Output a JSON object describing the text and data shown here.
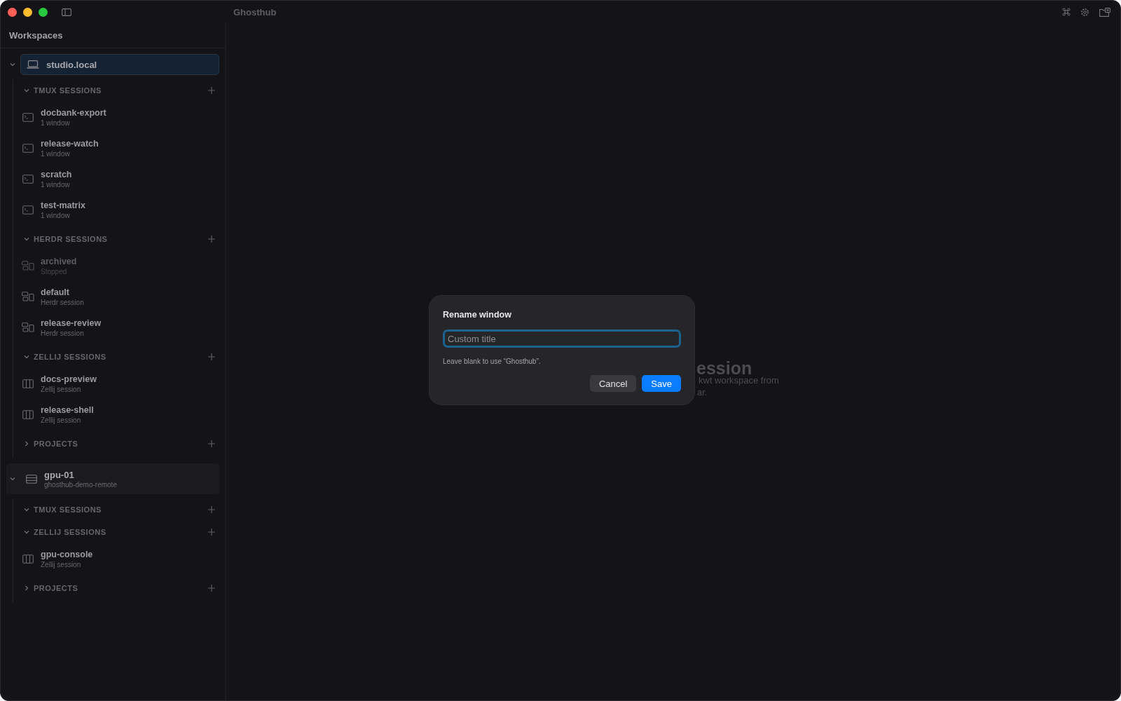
{
  "window": {
    "title": "Ghosthub"
  },
  "sidebar": {
    "title": "Workspaces",
    "workspaces": [
      {
        "name": "studio.local",
        "kind": "laptop",
        "selected": true,
        "expanded": true,
        "groups": [
          {
            "label": "TMUX SESSIONS",
            "expanded": true,
            "items": [
              {
                "name": "docbank-export",
                "detail": "1 window",
                "kind": "terminal",
                "disabled": false
              },
              {
                "name": "release-watch",
                "detail": "1 window",
                "kind": "terminal",
                "disabled": false
              },
              {
                "name": "scratch",
                "detail": "1 window",
                "kind": "terminal",
                "disabled": false
              },
              {
                "name": "test-matrix",
                "detail": "1 window",
                "kind": "terminal",
                "disabled": false
              }
            ]
          },
          {
            "label": "HERDR SESSIONS",
            "expanded": true,
            "items": [
              {
                "name": "archived",
                "detail": "Stopped",
                "kind": "panes",
                "disabled": true
              },
              {
                "name": "default",
                "detail": "Herdr session",
                "kind": "panes",
                "disabled": false
              },
              {
                "name": "release-review",
                "detail": "Herdr session",
                "kind": "panes",
                "disabled": false
              }
            ]
          },
          {
            "label": "ZELLIJ SESSIONS",
            "expanded": true,
            "items": [
              {
                "name": "docs-preview",
                "detail": "Zellij session",
                "kind": "columns",
                "disabled": false
              },
              {
                "name": "release-shell",
                "detail": "Zellij session",
                "kind": "columns",
                "disabled": false
              }
            ]
          },
          {
            "label": "PROJECTS",
            "expanded": false
          }
        ]
      },
      {
        "name": "gpu-01",
        "subtitle": "ghosthub-demo-remote",
        "kind": "server",
        "selected": false,
        "expanded": true,
        "groups": [
          {
            "label": "TMUX SESSIONS",
            "expanded": true
          },
          {
            "label": "ZELLIJ SESSIONS",
            "expanded": true,
            "items": [
              {
                "name": "gpu-console",
                "detail": "Zellij session",
                "kind": "columns",
                "disabled": false
              }
            ]
          },
          {
            "label": "PROJECTS",
            "expanded": false
          }
        ]
      }
    ]
  },
  "background": {
    "heading": "ession",
    "lines": [
      "kwt workspace from",
      "ar."
    ]
  },
  "dialog": {
    "title": "Rename window",
    "field": {
      "placeholder": "Custom title"
    },
    "hint": "Leave blank to use “Ghosthub”.",
    "buttons": [
      {
        "label": "Cancel",
        "kind": "secondary"
      },
      {
        "label": "Save",
        "kind": "primary"
      }
    ]
  }
}
